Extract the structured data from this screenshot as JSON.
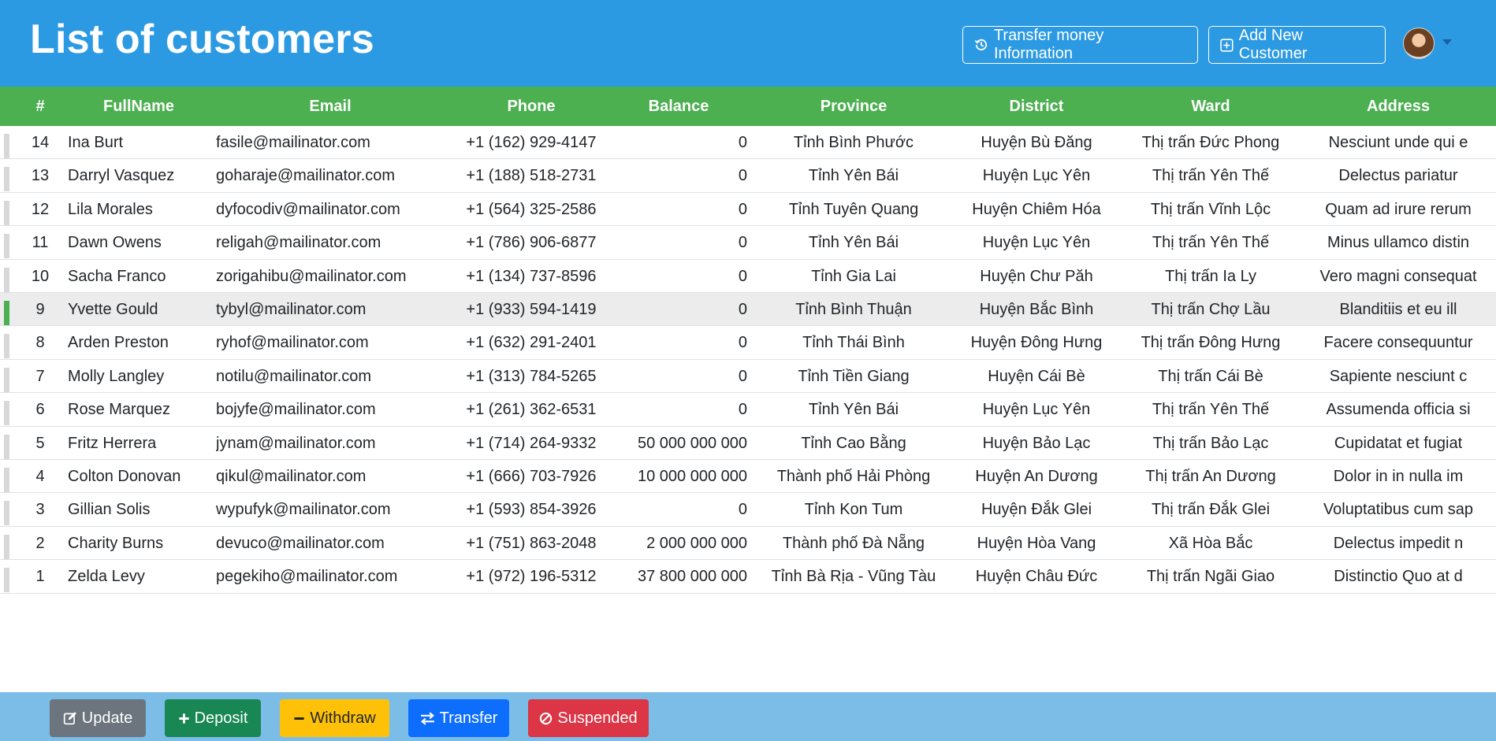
{
  "header": {
    "title": "List of customers",
    "transfer_info_label": "Transfer money Information",
    "add_customer_label": "Add New Customer"
  },
  "table": {
    "columns": [
      "#",
      "FullName",
      "Email",
      "Phone",
      "Balance",
      "Province",
      "District",
      "Ward",
      "Address"
    ],
    "rows": [
      {
        "id": "14",
        "name": "Ina Burt",
        "email": "fasile@mailinator.com",
        "phone": "+1 (162) 929-4147",
        "balance": "0",
        "province": "Tỉnh Bình Phước",
        "district": "Huyện Bù Đăng",
        "ward": "Thị trấn Đức Phong",
        "address": "Nesciunt unde qui e"
      },
      {
        "id": "13",
        "name": "Darryl Vasquez",
        "email": "goharaje@mailinator.com",
        "phone": "+1 (188) 518-2731",
        "balance": "0",
        "province": "Tỉnh Yên Bái",
        "district": "Huyện Lục Yên",
        "ward": "Thị trấn Yên Thế",
        "address": "Delectus pariatur"
      },
      {
        "id": "12",
        "name": "Lila Morales",
        "email": "dyfocodiv@mailinator.com",
        "phone": "+1 (564) 325-2586",
        "balance": "0",
        "province": "Tỉnh Tuyên Quang",
        "district": "Huyện Chiêm Hóa",
        "ward": "Thị trấn Vĩnh Lộc",
        "address": "Quam ad irure rerum"
      },
      {
        "id": "11",
        "name": "Dawn Owens",
        "email": "religah@mailinator.com",
        "phone": "+1 (786) 906-6877",
        "balance": "0",
        "province": "Tỉnh Yên Bái",
        "district": "Huyện Lục Yên",
        "ward": "Thị trấn Yên Thế",
        "address": "Minus ullamco distin"
      },
      {
        "id": "10",
        "name": "Sacha Franco",
        "email": "zorigahibu@mailinator.com",
        "phone": "+1 (134) 737-8596",
        "balance": "0",
        "province": "Tỉnh Gia Lai",
        "district": "Huyện Chư Păh",
        "ward": "Thị trấn Ia Ly",
        "address": "Vero magni consequat"
      },
      {
        "id": "9",
        "name": "Yvette Gould",
        "email": "tybyl@mailinator.com",
        "phone": "+1 (933) 594-1419",
        "balance": "0",
        "province": "Tỉnh Bình Thuận",
        "district": "Huyện Bắc Bình",
        "ward": "Thị trấn Chợ Lầu",
        "address": "Blanditiis et eu ill"
      },
      {
        "id": "8",
        "name": "Arden Preston",
        "email": "ryhof@mailinator.com",
        "phone": "+1 (632) 291-2401",
        "balance": "0",
        "province": "Tỉnh Thái Bình",
        "district": "Huyện Đông Hưng",
        "ward": "Thị trấn Đông Hưng",
        "address": "Facere consequuntur"
      },
      {
        "id": "7",
        "name": "Molly Langley",
        "email": "notilu@mailinator.com",
        "phone": "+1 (313) 784-5265",
        "balance": "0",
        "province": "Tỉnh Tiền Giang",
        "district": "Huyện Cái Bè",
        "ward": "Thị trấn Cái Bè",
        "address": "Sapiente nesciunt c"
      },
      {
        "id": "6",
        "name": "Rose Marquez",
        "email": "bojyfe@mailinator.com",
        "phone": "+1 (261) 362-6531",
        "balance": "0",
        "province": "Tỉnh Yên Bái",
        "district": "Huyện Lục Yên",
        "ward": "Thị trấn Yên Thế",
        "address": "Assumenda officia si"
      },
      {
        "id": "5",
        "name": "Fritz Herrera",
        "email": "jynam@mailinator.com",
        "phone": "+1 (714) 264-9332",
        "balance": "50 000 000 000",
        "province": "Tỉnh Cao Bằng",
        "district": "Huyện Bảo Lạc",
        "ward": "Thị trấn Bảo Lạc",
        "address": "Cupidatat et fugiat"
      },
      {
        "id": "4",
        "name": "Colton Donovan",
        "email": "qikul@mailinator.com",
        "phone": "+1 (666) 703-7926",
        "balance": "10 000 000 000",
        "province": "Thành phố Hải Phòng",
        "district": "Huyện An Dương",
        "ward": "Thị trấn An Dương",
        "address": "Dolor in in nulla im"
      },
      {
        "id": "3",
        "name": "Gillian Solis",
        "email": "wypufyk@mailinator.com",
        "phone": "+1 (593) 854-3926",
        "balance": "0",
        "province": "Tỉnh Kon Tum",
        "district": "Huyện Đắk Glei",
        "ward": "Thị trấn Đắk Glei",
        "address": "Voluptatibus cum sap"
      },
      {
        "id": "2",
        "name": "Charity Burns",
        "email": "devuco@mailinator.com",
        "phone": "+1 (751) 863-2048",
        "balance": "2 000 000 000",
        "province": "Thành phố Đà Nẵng",
        "district": "Huyện Hòa Vang",
        "ward": "Xã Hòa Bắc",
        "address": "Delectus impedit n"
      },
      {
        "id": "1",
        "name": "Zelda Levy",
        "email": "pegekiho@mailinator.com",
        "phone": "+1 (972) 196-5312",
        "balance": "37 800 000 000",
        "province": "Tỉnh Bà Rịa - Vũng Tàu",
        "district": "Huyện Châu Đức",
        "ward": "Thị trấn Ngãi Giao",
        "address": "Distinctio Quo at d"
      }
    ],
    "selected_id": "9"
  },
  "footer": {
    "update_label": "Update",
    "deposit_label": "Deposit",
    "withdraw_label": "Withdraw",
    "transfer_label": "Transfer",
    "suspended_label": "Suspended"
  },
  "colors": {
    "header_bg": "#2c9ae3",
    "table_header_bg": "#4caf50",
    "footer_bg": "#7cbde8",
    "update": "#6c757d",
    "deposit": "#198754",
    "withdraw": "#ffc107",
    "transfer": "#0d6efd",
    "suspended": "#dc3545"
  }
}
